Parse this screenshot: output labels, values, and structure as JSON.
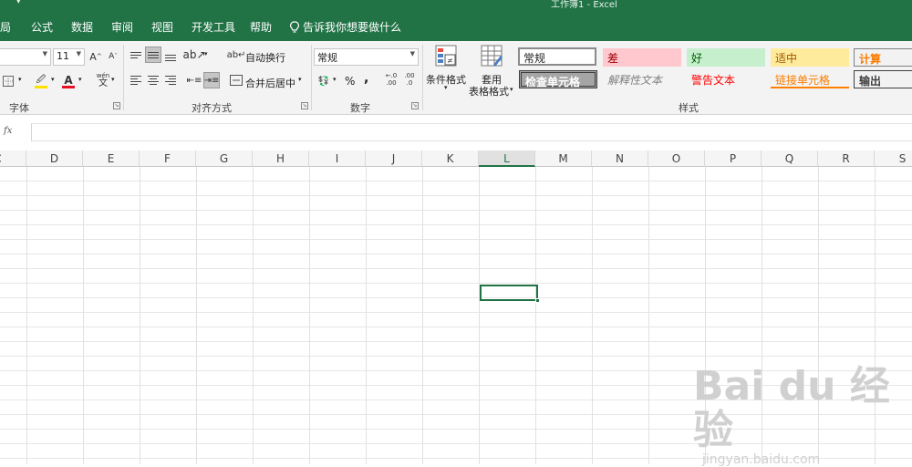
{
  "title_bar": {
    "title": "工作簿1  -  Excel",
    "quick_access": "▾"
  },
  "tabs": [
    {
      "label": "局"
    },
    {
      "label": "公式"
    },
    {
      "label": "数据"
    },
    {
      "label": "审阅"
    },
    {
      "label": "视图"
    },
    {
      "label": "开发工具"
    },
    {
      "label": "帮助"
    }
  ],
  "tell_me": {
    "label": "告诉我你想要做什么"
  },
  "font_group": {
    "font_name": "",
    "font_size": "11",
    "grow_label": "A",
    "shrink_label": "A",
    "fill_label": "🖉",
    "font_color_label": "A",
    "phonetic_label": "wén",
    "group_label": "字体",
    "font_color": "#e81123",
    "fill_color": "#ffe100"
  },
  "alignment_group": {
    "wrap_text": "自动换行",
    "merge_center": "合并后居中",
    "group_label": "对齐方式"
  },
  "number_group": {
    "format": "常规",
    "percent": "%",
    "comma": ",",
    "inc_decimal": ".00",
    "dec_decimal": ".0",
    "group_label": "数字"
  },
  "styles_group": {
    "conditional_format": "条件格式",
    "table_format_line1": "套用",
    "table_format_line2": "表格格式",
    "group_label": "样式",
    "cells": [
      {
        "label": "常规",
        "name": "style-normal"
      },
      {
        "label": "差",
        "name": "style-bad"
      },
      {
        "label": "好",
        "name": "style-good"
      },
      {
        "label": "适中",
        "name": "style-neutral"
      },
      {
        "label": "计算",
        "name": "style-calculation"
      },
      {
        "label": "检查单元格",
        "name": "style-check-cell"
      },
      {
        "label": "解释性文本",
        "name": "style-explanatory"
      },
      {
        "label": "警告文本",
        "name": "style-warning"
      },
      {
        "label": "链接单元格",
        "name": "style-linked-cell"
      },
      {
        "label": "输出",
        "name": "style-output"
      }
    ]
  },
  "formula_bar": {
    "fx_label": "fx",
    "value": ""
  },
  "columns": [
    "C",
    "D",
    "E",
    "F",
    "G",
    "H",
    "I",
    "J",
    "K",
    "L",
    "M",
    "N",
    "O",
    "P",
    "Q",
    "R",
    "S"
  ],
  "active_column": "L",
  "watermark": {
    "brand": "Bai du 经验",
    "url": "jingyan.baidu.com"
  },
  "colors": {
    "accent": "#217346",
    "ribbon": "#f3f3f3"
  }
}
